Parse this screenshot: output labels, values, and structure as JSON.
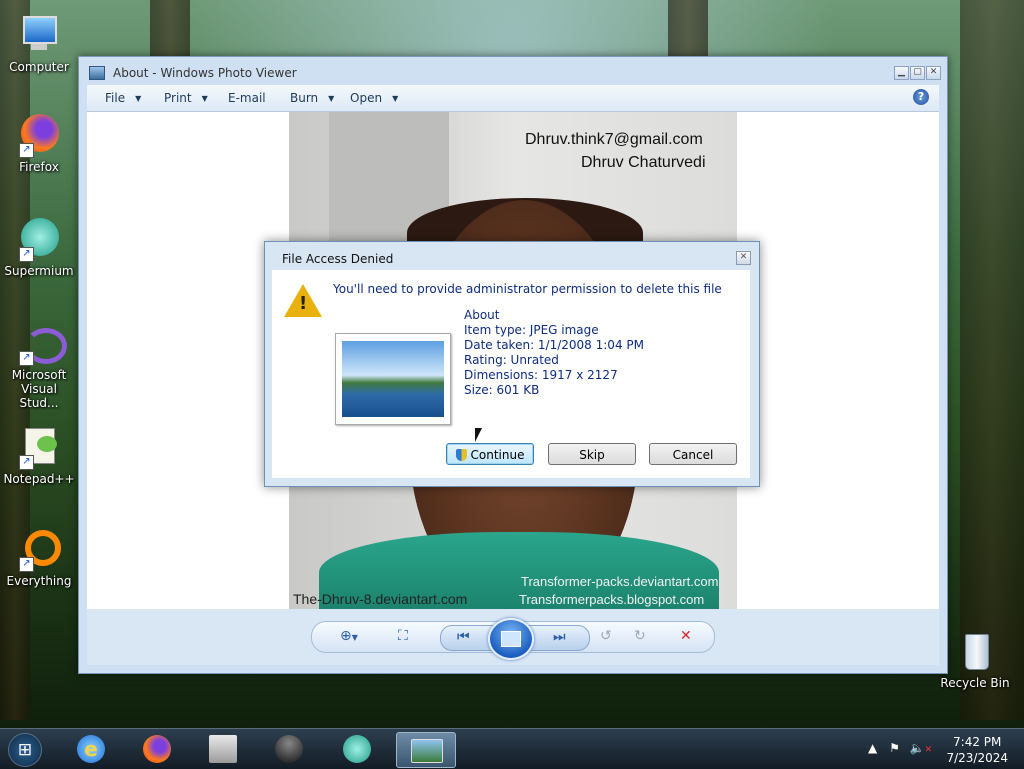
{
  "desktop_icons": [
    {
      "label": "Computer",
      "icon": "computer-icon"
    },
    {
      "label": "Firefox",
      "icon": "firefox-icon"
    },
    {
      "label": "Supermium",
      "icon": "supermium-icon"
    },
    {
      "label": "Microsoft Visual Stud...",
      "icon": "visual-studio-icon"
    },
    {
      "label": "Notepad++",
      "icon": "notepadpp-icon"
    },
    {
      "label": "Everything",
      "icon": "everything-icon"
    },
    {
      "label": "Recycle Bin",
      "icon": "recycle-bin-icon"
    }
  ],
  "photo_viewer": {
    "title": "About - Windows Photo Viewer",
    "menu": [
      "File",
      "Print",
      "E-mail",
      "Burn",
      "Open"
    ],
    "help": "?",
    "photo_watermarks": {
      "email": "Dhruv.think7@gmail.com",
      "name": "Dhruv Chaturvedi",
      "site1": "Transformer-packs.deviantart.com",
      "site2": "Transformerpacks.blogspot.com",
      "site3": "The-Dhruv-8.deviantart.com"
    }
  },
  "dialog": {
    "title": "File Access Denied",
    "message": "You'll need to provide administrator permission to delete this file",
    "file_name": "About",
    "item_type": "Item type: JPEG image",
    "date_taken": "Date taken: 1/1/2008 1:04 PM",
    "rating": "Rating: Unrated",
    "dimensions": "Dimensions: 1917 x 2127",
    "size": "Size: 601 KB",
    "buttons": {
      "continue": "Continue",
      "skip": "Skip",
      "cancel": "Cancel"
    }
  },
  "taskbar": {
    "clock_time": "7:42 PM",
    "clock_date": "7/23/2024"
  },
  "colors": {
    "dialog_text": "#0d2c82",
    "warning": "#e8b10d",
    "delete_red": "#d22a2a"
  }
}
